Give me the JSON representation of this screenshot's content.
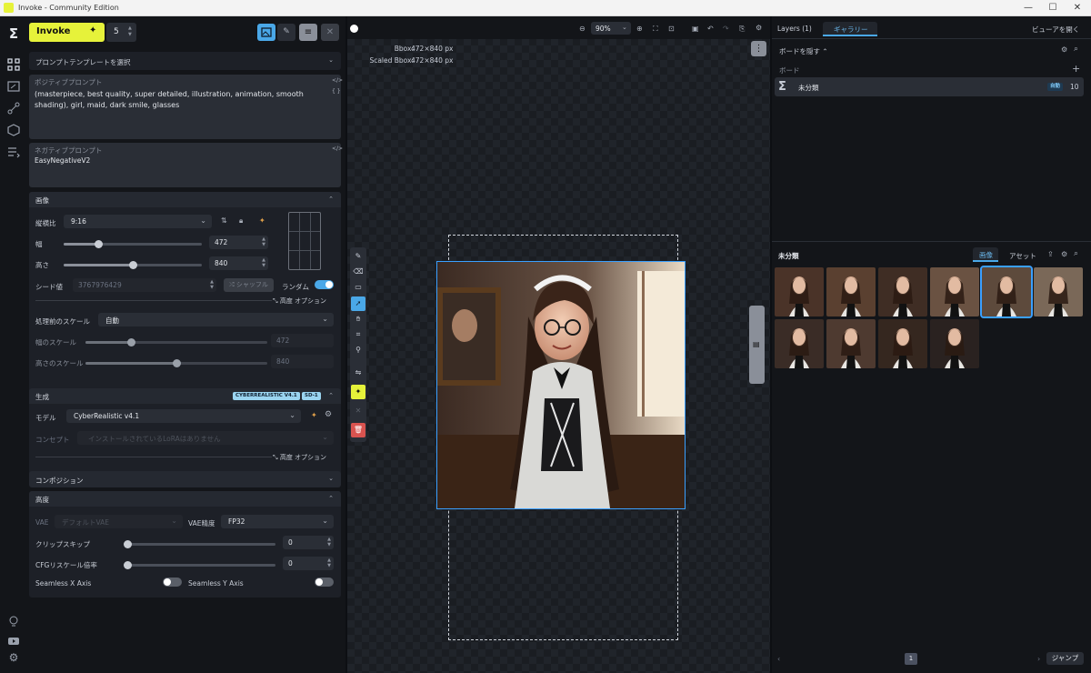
{
  "window": {
    "title": "Invoke - Community Edition"
  },
  "topbar": {
    "invoke_label": "Invoke",
    "iterations": "5"
  },
  "prompt_template": {
    "label": "プロンプトテンプレートを選択"
  },
  "positive": {
    "label": "ポジティブプロンプト",
    "text": "(masterpiece, best quality, super detailed, illustration, animation, smooth shading), girl, maid, dark smile, glasses"
  },
  "negative": {
    "label": "ネガティブプロンプト",
    "text": "EasyNegativeV2"
  },
  "image_section": {
    "title": "画像",
    "aspect_label": "縦横比",
    "aspect_value": "9:16",
    "width_label": "幅",
    "width_value": "472",
    "width_fraction": 0.25,
    "height_label": "高さ",
    "height_value": "840",
    "height_fraction": 0.5,
    "seed_label": "シード値",
    "seed_value": "3767976429",
    "shuffle_label": "シャッフル",
    "random_label": "ランダム",
    "advanced_label": "高度 オプション",
    "prescale_label": "処理前のスケール",
    "prescale_value": "自動",
    "scale_w_label": "幅のスケール",
    "scale_w_value": "472",
    "scale_w_fraction": 0.25,
    "scale_h_label": "高さのスケール",
    "scale_h_value": "840",
    "scale_h_fraction": 0.5
  },
  "gen_section": {
    "title": "生成",
    "badge1": "CYBERREALISTIC V4.1",
    "badge2": "SD-1",
    "model_label": "モデル",
    "model_value": "CyberRealistic v4.1",
    "concept_label": "コンセプト",
    "concept_placeholder": "インストールされているLoRAはありません",
    "advanced_label": "高度 オプション"
  },
  "composition": {
    "title": "コンポジション"
  },
  "advanced": {
    "title": "高度",
    "vae_label": "VAE",
    "vae_value": "デフォルトVAE",
    "vae_precision_label": "VAE精度",
    "vae_precision_value": "FP32",
    "clip_label": "クリップスキップ",
    "clip_value": "0",
    "cfg_label": "CFGリスケール倍率",
    "cfg_value": "0",
    "seamless_x": "Seamless X Axis",
    "seamless_y": "Seamless Y Axis"
  },
  "canvas": {
    "zoom": "90%",
    "bbox_label": "Bbox:",
    "bbox_value": "472×840 px",
    "scaled_label": "Scaled Bbox:",
    "scaled_value": "472×840 px"
  },
  "right": {
    "tab_layers": "Layers (1)",
    "tab_gallery": "ギャラリー",
    "open_viewer": "ビューアを開く",
    "hide_boards": "ボードを隠す",
    "boards_label": "ボード",
    "board_name": "未分類",
    "board_badge": "自動",
    "board_count": "10",
    "gallery_title": "未分類",
    "tab_images": "画像",
    "tab_assets": "アセット",
    "page": "1",
    "jump": "ジャンプ"
  },
  "colors": {
    "accent": "#e6f23a",
    "selection": "#3aa0ff",
    "bg": "#131519"
  }
}
